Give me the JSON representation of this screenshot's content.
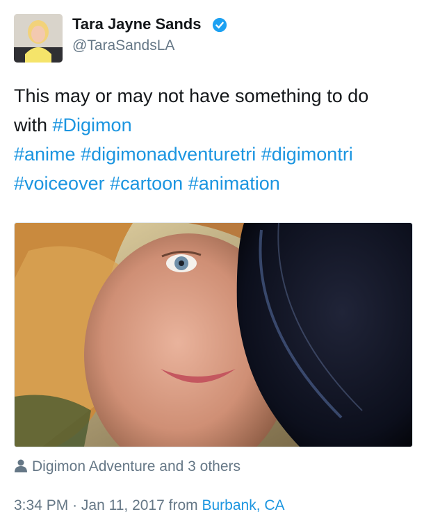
{
  "tweet": {
    "author": {
      "display_name": "Tara Jayne Sands",
      "handle": "@TaraSandsLA",
      "verified": true,
      "avatar_icon": "profile-photo"
    },
    "text": {
      "line1": "This may or may not have something to do",
      "line2_plain": "with ",
      "hashtags": [
        "#Digimon",
        "#anime",
        "#digimonadventuretri",
        "#digimontri",
        "#voiceover",
        "#cartoon",
        "#animation"
      ]
    },
    "media": {
      "type": "photo",
      "subject": "selfie-with-microphone-screen"
    },
    "tagged": {
      "icon": "person-icon",
      "text": "Digimon Adventure and 3 others"
    },
    "meta": {
      "time": "3:34 PM",
      "separator": "·",
      "date": "Jan 11, 2017",
      "from_label": "from",
      "place": "Burbank, CA"
    }
  },
  "colors": {
    "link": "#1b95e0",
    "secondary_text": "#657786",
    "primary_text": "#14171a",
    "verified_badge": "#1da1f2"
  }
}
